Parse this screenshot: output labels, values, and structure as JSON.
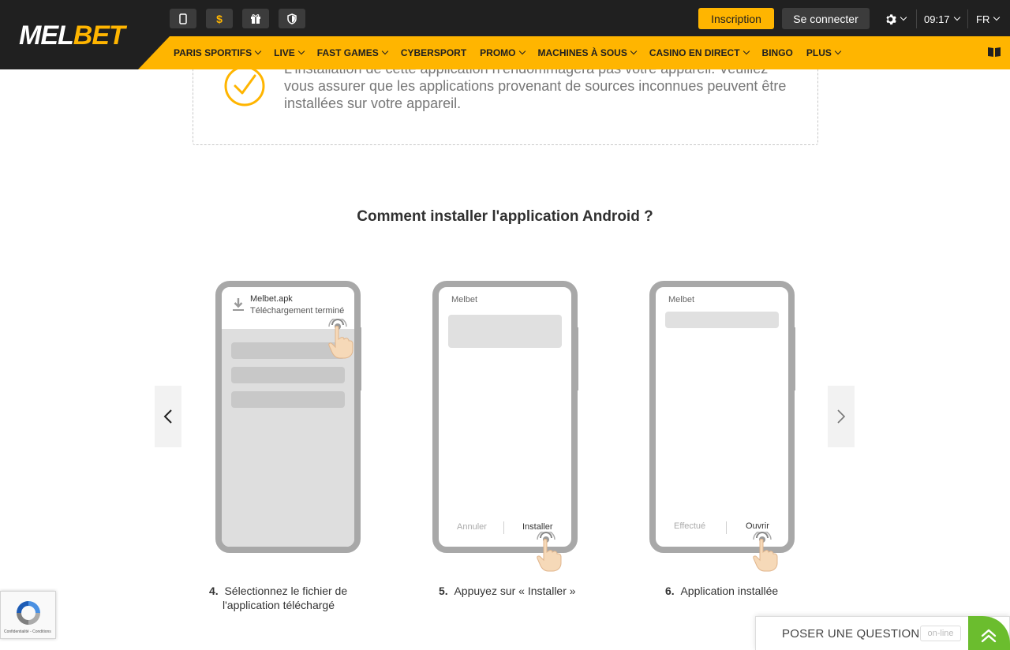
{
  "brand": {
    "logo_mel": "MEL",
    "logo_bet": "BET",
    "accent": "#ffb500",
    "header_bg": "#202020"
  },
  "header": {
    "icons": [
      "mobile-icon",
      "dollar-icon",
      "gift-icon",
      "shield-icon"
    ],
    "dollar_glyph": "$",
    "register_label": "Inscription",
    "login_label": "Se connecter",
    "time": "09:17",
    "language": "FR"
  },
  "nav": {
    "items": [
      {
        "label": "PARIS SPORTIFS",
        "dropdown": true
      },
      {
        "label": "LIVE",
        "dropdown": true
      },
      {
        "label": "FAST GAMES",
        "dropdown": true
      },
      {
        "label": "CYBERSPORT",
        "dropdown": false
      },
      {
        "label": "PROMO",
        "dropdown": true
      },
      {
        "label": "MACHINES À SOUS",
        "dropdown": true
      },
      {
        "label": "CASINO EN DIRECT",
        "dropdown": true
      },
      {
        "label": "BINGO",
        "dropdown": false
      },
      {
        "label": "PLUS",
        "dropdown": true
      }
    ]
  },
  "notice": {
    "text": "L'installation de cette application n'endommagera pas votre appareil. Veuillez vous assurer que les applications provenant de sources inconnues peuvent être installées sur votre appareil."
  },
  "section": {
    "title": "Comment installer l'application Android ?",
    "steps": [
      {
        "number": "4.",
        "text_line1": "Sélectionnez le fichier de",
        "text_line2": "l'application téléchargé",
        "file_name": "Melbet.apk",
        "file_status": "Téléchargement terminé"
      },
      {
        "number": "5.",
        "text_line1": "Appuyez sur « Installer »",
        "app_label": "Melbet",
        "cancel_label": "Annuler",
        "install_label": "Installer"
      },
      {
        "number": "6.",
        "text_line1": "Application installée",
        "app_label": "Melbet",
        "done_label": "Effectué",
        "open_label": "Ouvrir"
      }
    ]
  },
  "recaptcha": {
    "text": "Confidentialité - Conditions"
  },
  "question": {
    "label": "POSER UNE QUESTION",
    "status": "on-line"
  }
}
